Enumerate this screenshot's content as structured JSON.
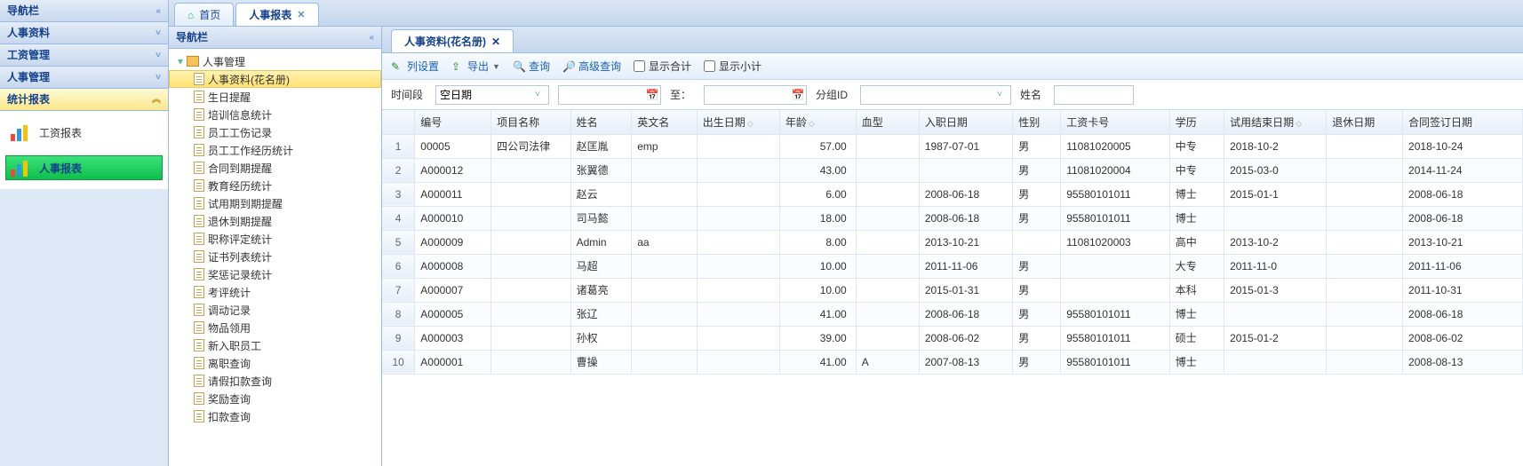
{
  "leftnav": {
    "title": "导航栏",
    "sections": [
      {
        "label": "人事资料",
        "open": false
      },
      {
        "label": "工资管理",
        "open": false
      },
      {
        "label": "人事管理",
        "open": false
      },
      {
        "label": "统计报表",
        "open": true
      }
    ],
    "reports": [
      {
        "label": "工资报表",
        "active": false
      },
      {
        "label": "人事报表",
        "active": true
      }
    ]
  },
  "tabs": [
    {
      "label": "首页",
      "closable": false,
      "icon": "home"
    },
    {
      "label": "人事报表",
      "closable": true,
      "active": true
    }
  ],
  "tree": {
    "title": "导航栏",
    "root": "人事管理",
    "items": [
      "人事资料(花名册)",
      "生日提醒",
      "培训信息统计",
      "员工工伤记录",
      "员工工作经历统计",
      "合同到期提醒",
      "教育经历统计",
      "试用期到期提醒",
      "退休到期提醒",
      "职称评定统计",
      "证书列表统计",
      "奖惩记录统计",
      "考评统计",
      "调动记录",
      "物品领用",
      "新入职员工",
      "离职查询",
      "请假扣款查询",
      "奖励查询",
      "扣款查询"
    ],
    "selected": 0
  },
  "subtab": "人事资料(花名册)",
  "toolbar": {
    "col_settings": "列设置",
    "export": "导出",
    "search": "查询",
    "adv_search": "高级查询",
    "show_total": "显示合计",
    "show_subtotal": "显示小计"
  },
  "filters": {
    "time_label": "时间段",
    "date_type": "空日期",
    "to_label": "至：",
    "group_label": "分组ID",
    "name_label": "姓名"
  },
  "grid": {
    "columns": [
      "编号",
      "项目名称",
      "姓名",
      "英文名",
      "出生日期",
      "年龄",
      "血型",
      "入职日期",
      "性别",
      "工资卡号",
      "学历",
      "试用结束日期",
      "退休日期",
      "合同签订日期"
    ],
    "sortable_cols": [
      4,
      5,
      11
    ],
    "rows": [
      {
        "no": "00005",
        "proj": "四公司法律",
        "name": "赵匡胤",
        "en": "emp",
        "birth": "",
        "age": "57.00",
        "blood": "",
        "hire": "1987-07-01",
        "sex": "男",
        "card": "11081020005",
        "edu": "中专",
        "probation": "2018-10-2",
        "retire": "",
        "contract": "2018-10-24"
      },
      {
        "no": "A000012",
        "proj": "",
        "name": "张翼德",
        "en": "",
        "birth": "",
        "age": "43.00",
        "blood": "",
        "hire": "",
        "sex": "男",
        "card": "11081020004",
        "edu": "中专",
        "probation": "2015-03-0",
        "retire": "",
        "contract": "2014-11-24"
      },
      {
        "no": "A000011",
        "proj": "",
        "name": "赵云",
        "en": "",
        "birth": "",
        "age": "6.00",
        "blood": "",
        "hire": "2008-06-18",
        "sex": "男",
        "card": "95580101011",
        "edu": "博士",
        "probation": "2015-01-1",
        "retire": "",
        "contract": "2008-06-18"
      },
      {
        "no": "A000010",
        "proj": "",
        "name": "司马懿",
        "en": "",
        "birth": "",
        "age": "18.00",
        "blood": "",
        "hire": "2008-06-18",
        "sex": "男",
        "card": "95580101011",
        "edu": "博士",
        "probation": "",
        "retire": "",
        "contract": "2008-06-18"
      },
      {
        "no": "A000009",
        "proj": "",
        "name": "Admin",
        "en": "aa",
        "birth": "",
        "age": "8.00",
        "blood": "",
        "hire": "2013-10-21",
        "sex": "",
        "card": "11081020003",
        "edu": "高中",
        "probation": "2013-10-2",
        "retire": "",
        "contract": "2013-10-21"
      },
      {
        "no": "A000008",
        "proj": "",
        "name": "马超",
        "en": "",
        "birth": "",
        "age": "10.00",
        "blood": "",
        "hire": "2011-11-06",
        "sex": "男",
        "card": "",
        "edu": "大专",
        "probation": "2011-11-0",
        "retire": "",
        "contract": "2011-11-06"
      },
      {
        "no": "A000007",
        "proj": "",
        "name": "诸葛亮",
        "en": "",
        "birth": "",
        "age": "10.00",
        "blood": "",
        "hire": "2015-01-31",
        "sex": "男",
        "card": "",
        "edu": "本科",
        "probation": "2015-01-3",
        "retire": "",
        "contract": "2011-10-31"
      },
      {
        "no": "A000005",
        "proj": "",
        "name": "张辽",
        "en": "",
        "birth": "",
        "age": "41.00",
        "blood": "",
        "hire": "2008-06-18",
        "sex": "男",
        "card": "95580101011",
        "edu": "博士",
        "probation": "",
        "retire": "",
        "contract": "2008-06-18"
      },
      {
        "no": "A000003",
        "proj": "",
        "name": "孙权",
        "en": "",
        "birth": "",
        "age": "39.00",
        "blood": "",
        "hire": "2008-06-02",
        "sex": "男",
        "card": "95580101011",
        "edu": "硕士",
        "probation": "2015-01-2",
        "retire": "",
        "contract": "2008-06-02"
      },
      {
        "no": "A000001",
        "proj": "",
        "name": "曹操",
        "en": "",
        "birth": "",
        "age": "41.00",
        "blood": "A",
        "hire": "2007-08-13",
        "sex": "男",
        "card": "95580101011",
        "edu": "博士",
        "probation": "",
        "retire": "",
        "contract": "2008-08-13"
      }
    ]
  }
}
